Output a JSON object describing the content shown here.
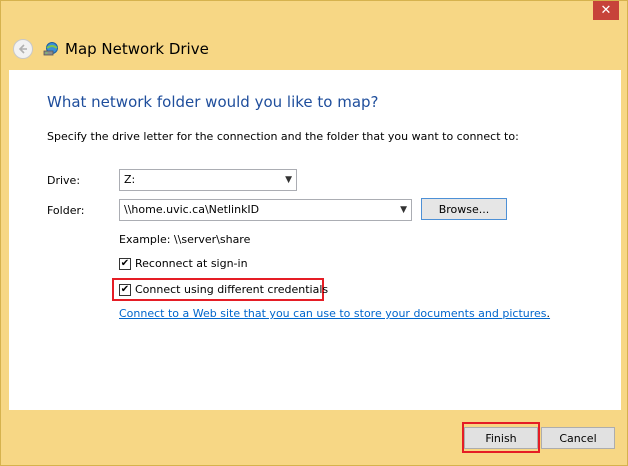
{
  "window": {
    "title": "Map Network Drive",
    "close_glyph": "✕"
  },
  "icons": {
    "back": "back-arrow-icon",
    "network_drive": "network-drive-icon",
    "close": "close-icon",
    "dropdown": "chevron-down-icon",
    "check": "checkmark-icon"
  },
  "main": {
    "heading": "What network folder would you like to map?",
    "instruction": "Specify the drive letter for the connection and the folder that you want to connect to:",
    "drive": {
      "label": "Drive:",
      "value": "Z:"
    },
    "folder": {
      "label": "Folder:",
      "value": "\\\\home.uvic.ca\\NetlinkID",
      "browse_label": "Browse..."
    },
    "example": "Example: \\\\server\\share",
    "reconnect": {
      "label": "Reconnect at sign-in",
      "checked": true
    },
    "different_credentials": {
      "label": "Connect using different credentials",
      "checked": true
    },
    "link": "Connect to a Web site that you can use to store your documents and pictures",
    "link_suffix": "."
  },
  "footer": {
    "finish_label": "Finish",
    "cancel_label": "Cancel"
  },
  "colors": {
    "frame": "#f7d785",
    "heading": "#1f4e9c",
    "link": "#0066cc",
    "highlight": "#e51d25",
    "close": "#c7433a"
  }
}
